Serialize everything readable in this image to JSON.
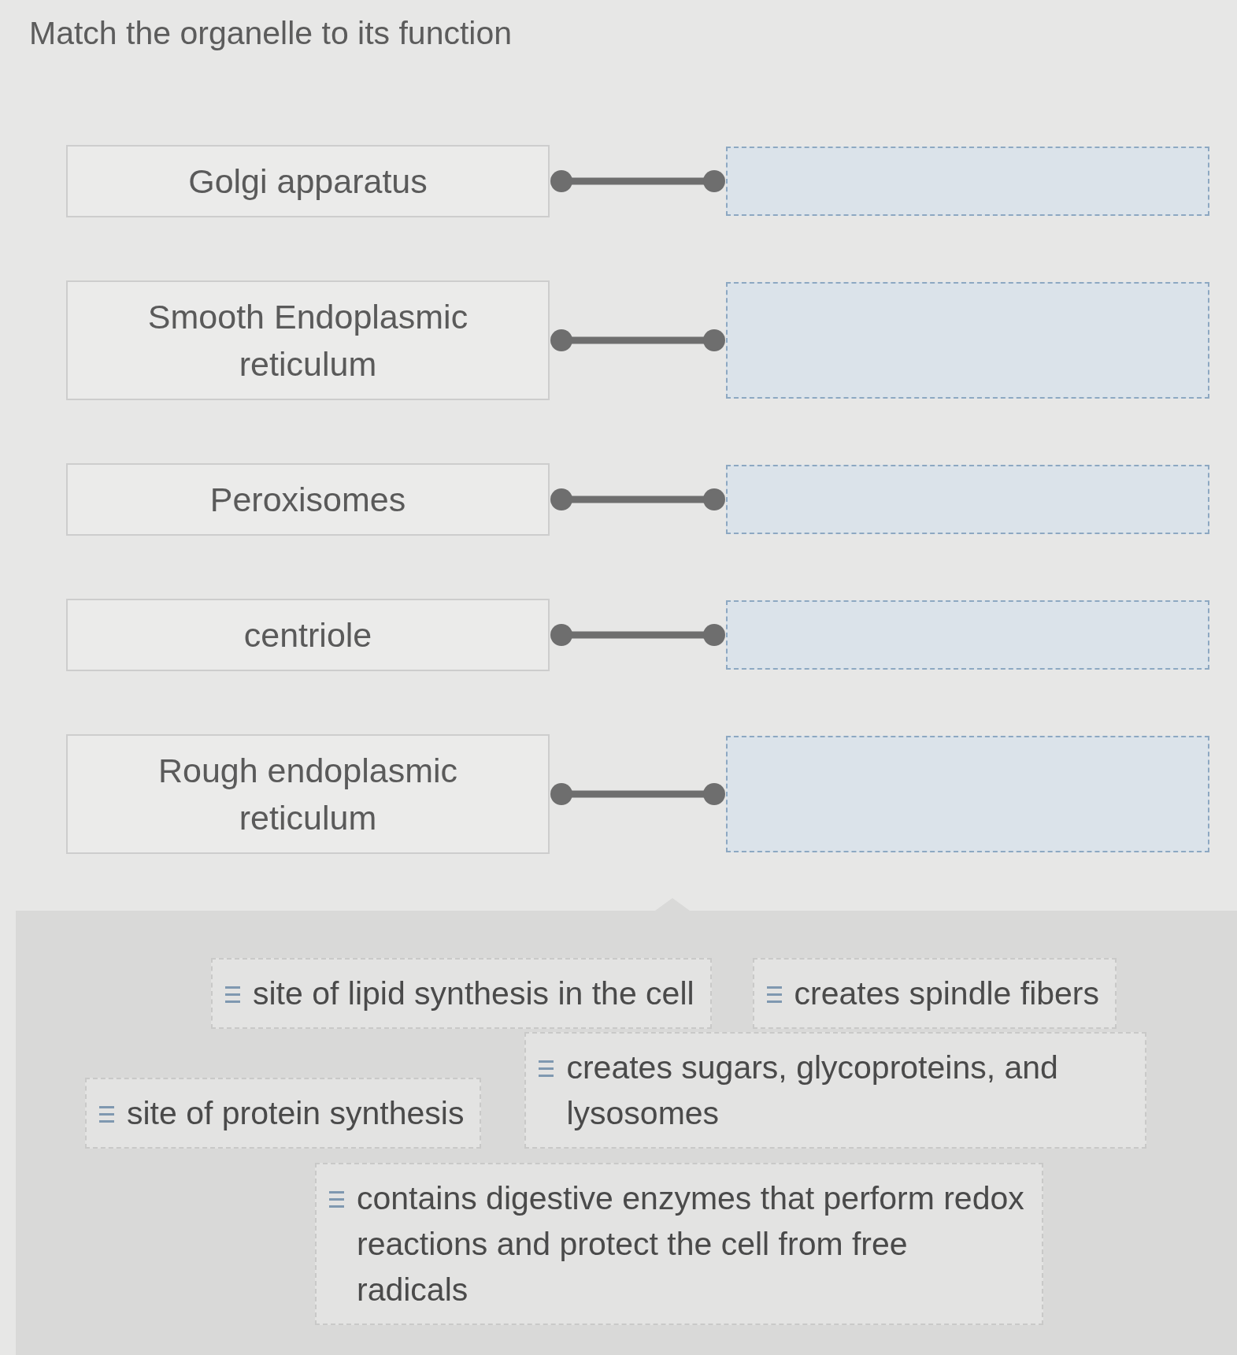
{
  "title": "Match the organelle to its function",
  "pairs": [
    {
      "organelle": "Golgi apparatus"
    },
    {
      "organelle": "Smooth Endoplasmic reticulum"
    },
    {
      "organelle": "Peroxisomes"
    },
    {
      "organelle": "centriole"
    },
    {
      "organelle": "Rough endoplasmic reticulum"
    }
  ],
  "answer_bank": [
    {
      "text": "site of lipid synthesis in the cell"
    },
    {
      "text": "creates spindle fibers"
    },
    {
      "text": "site of protein synthesis"
    },
    {
      "text": "creates sugars, glycoproteins, and lysosomes"
    },
    {
      "text": "contains digestive enzymes that perform redox reactions and protect the cell from free radicals"
    }
  ]
}
